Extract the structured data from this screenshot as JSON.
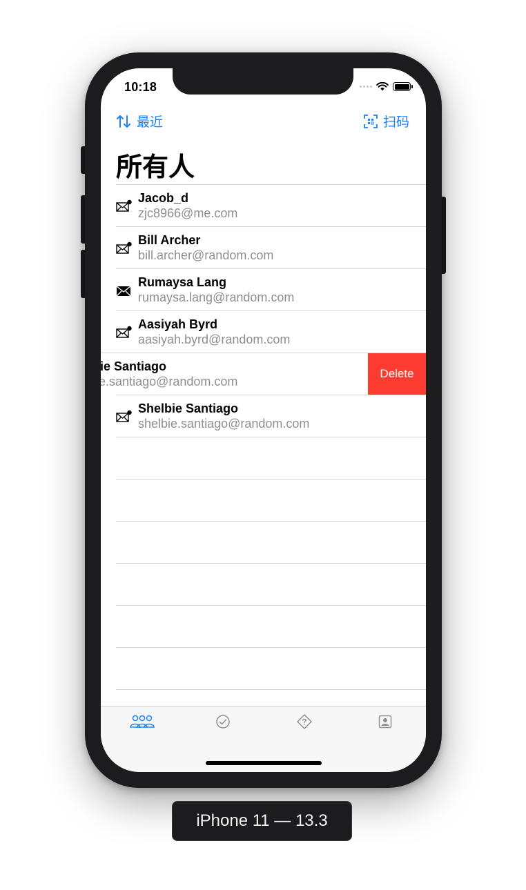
{
  "status_bar": {
    "time": "10:18"
  },
  "nav": {
    "sort_label": "最近",
    "scan_label": "扫码"
  },
  "page_title": "所有人",
  "contacts": [
    {
      "name": "Jacob_d",
      "email": "zjc8966@me.com",
      "icon": "mail-unread-icon",
      "swiped": false
    },
    {
      "name": "Bill Archer",
      "email": "bill.archer@random.com",
      "icon": "mail-unread-icon",
      "swiped": false
    },
    {
      "name": "Rumaysa Lang",
      "email": "rumaysa.lang@random.com",
      "icon": "mail-filled-icon",
      "swiped": false
    },
    {
      "name": "Aasiyah Byrd",
      "email": "aasiyah.byrd@random.com",
      "icon": "mail-unread-icon",
      "swiped": false
    },
    {
      "name": "Shelbie Santiago",
      "email": "shelbie.santiago@random.com",
      "icon": "mail-unread-icon",
      "swiped": true
    },
    {
      "name": "Shelbie Santiago",
      "email": "shelbie.santiago@random.com",
      "icon": "mail-unread-icon",
      "swiped": false
    }
  ],
  "swipe_action": {
    "delete_label": "Delete",
    "color": "#fe3b30"
  },
  "tabs": [
    {
      "icon": "people-icon",
      "active": true
    },
    {
      "icon": "checkmark-circle-icon",
      "active": false
    },
    {
      "icon": "question-diamond-icon",
      "active": false
    },
    {
      "icon": "contact-card-icon",
      "active": false
    }
  ],
  "device_label": "iPhone 11 — 13.3",
  "colors": {
    "accent": "#1a82fb",
    "delete": "#fe3b30",
    "secondary_text": "#8e8e93"
  }
}
